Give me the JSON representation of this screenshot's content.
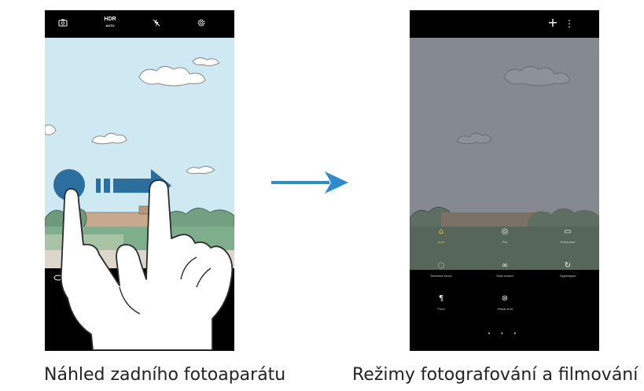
{
  "left_screen": {
    "top_icons": [
      "camera-switch-icon",
      "hdr-icon",
      "flash-off-icon",
      "settings-gear-icon"
    ],
    "hdr_label": "HDR",
    "hdr_sublabel": "AUTO"
  },
  "right_screen": {
    "top_icons": [
      "plus-icon",
      "more-options-icon"
    ],
    "plus_glyph": "+",
    "more_glyph": "⋮",
    "modes": [
      {
        "icon": "auto-mode-icon",
        "glyph": "⌂",
        "label": "Auto",
        "selected": true
      },
      {
        "icon": "pro-mode-icon",
        "glyph": "◎",
        "label": "Pro"
      },
      {
        "icon": "panorama-icon",
        "glyph": "▭",
        "label": "Panorama"
      },
      {
        "icon": "selective-focus-icon",
        "glyph": "◌",
        "label": "Selective focus"
      },
      {
        "icon": "slow-motion-icon",
        "glyph": "∞",
        "label": "Slow motion"
      },
      {
        "icon": "hyperlapse-icon",
        "glyph": "↻",
        "label": "Hyperlapse"
      },
      {
        "icon": "food-icon",
        "glyph": "¶",
        "label": "Food"
      },
      {
        "icon": "virtual-shot-icon",
        "glyph": "⊛",
        "label": "Virtual shot"
      }
    ],
    "page_dots": "• • •"
  },
  "captions": {
    "left": "Náhled zadního fotoaparátu",
    "right": "Režimy fotografování a filmování"
  },
  "colors": {
    "sky": "#cfe9f3",
    "dimmed_view": "#858a90",
    "arrow_blue": "#2e8bd0",
    "swipe_blue": "#2a6f9f",
    "selected_mode": "#e6c34a"
  }
}
